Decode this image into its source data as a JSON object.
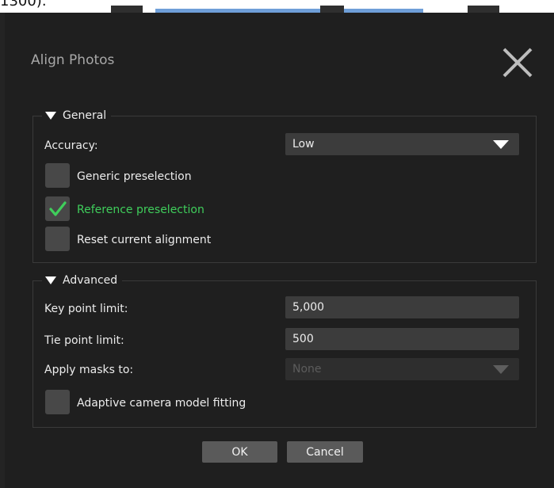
{
  "background_caption": "1300).",
  "dialog": {
    "title": "Align Photos",
    "close_icon": "close-icon"
  },
  "general": {
    "heading": "General",
    "accuracy_label": "Accuracy:",
    "accuracy_value": "Low",
    "generic_preselection": {
      "label": "Generic preselection",
      "checked": false
    },
    "reference_preselection": {
      "label": "Reference preselection",
      "checked": true
    },
    "reset_current_alignment": {
      "label": "Reset current alignment",
      "checked": false
    }
  },
  "advanced": {
    "heading": "Advanced",
    "key_point_limit_label": "Key point limit:",
    "key_point_limit_value": "5,000",
    "tie_point_limit_label": "Tie point limit:",
    "tie_point_limit_value": "500",
    "apply_masks_label": "Apply masks to:",
    "apply_masks_value": "None",
    "adaptive_camera_model_fitting": {
      "label": "Adaptive camera model fitting",
      "checked": false
    }
  },
  "buttons": {
    "ok": "OK",
    "cancel": "Cancel"
  },
  "colors": {
    "dialog_bg": "#1f1f1f",
    "accent_checked": "#3fce5b",
    "field_bg": "#3c3c3c",
    "button_bg": "#5a5a5a"
  }
}
